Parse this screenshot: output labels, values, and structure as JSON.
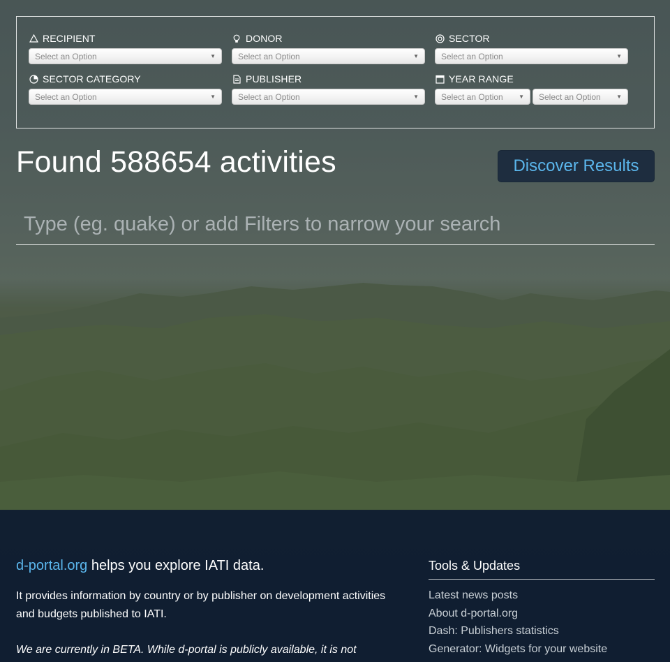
{
  "filters": {
    "recipient": {
      "label": "RECIPIENT",
      "placeholder": "Select an Option",
      "icon": "triangle-icon"
    },
    "donor": {
      "label": "DONOR",
      "placeholder": "Select an Option",
      "icon": "lightbulb-icon"
    },
    "sector": {
      "label": "SECTOR",
      "placeholder": "Select an Option",
      "icon": "target-icon"
    },
    "sector_category": {
      "label": "SECTOR CATEGORY",
      "placeholder": "Select an Option",
      "icon": "pie-chart-icon"
    },
    "publisher": {
      "label": "PUBLISHER",
      "placeholder": "Select an Option",
      "icon": "document-icon"
    },
    "year_range": {
      "label": "YEAR RANGE",
      "from_placeholder": "Select an Option",
      "to_placeholder": "Select an Option",
      "icon": "calendar-icon"
    },
    "arrow": "▼"
  },
  "results": {
    "found_text": "Found 588654 activities",
    "discover_label": "Discover Results"
  },
  "search": {
    "placeholder": "Type (eg. quake) or add Filters to narrow your search"
  },
  "footer": {
    "brand": "d-portal.org",
    "intro_rest": " helps you explore IATI data.",
    "description": "It provides information by country or by publisher on development activities and budgets published to IATI.",
    "beta": "We are currently in BETA. While d-portal is publicly available, it is not",
    "tools_title": "Tools & Updates",
    "tools_links": [
      "Latest news posts",
      "About d-portal.org",
      "Dash: Publishers statistics",
      "Generator: Widgets for your website"
    ]
  },
  "colors": {
    "accent": "#5bb6ec",
    "button_bg": "#1e2d3f",
    "footer_bg": "#101e30"
  }
}
